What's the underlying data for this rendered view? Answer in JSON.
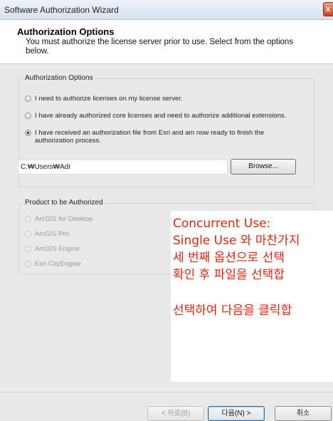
{
  "window": {
    "title": "Software Authorization Wizard",
    "close_label": "x"
  },
  "header": {
    "title": "Authorization Options",
    "subtitle": "You must authorize the license server prior to use. Select from the options below."
  },
  "auth_group": {
    "legend": "Authorization Options",
    "options": [
      {
        "label": "I need to authorize licenses on my license server.",
        "selected": false
      },
      {
        "label": "I have already authorized core licenses and need to authorize additional extensions.",
        "selected": false
      },
      {
        "label_line1": "I have received an authorization file from Esri and am now ready to finish the",
        "label_line2": "authorization process.",
        "selected": true
      }
    ],
    "path_value": "C:₩Users₩Adr",
    "browse_label": "Browse..."
  },
  "product_group": {
    "legend": "Product to be Authorized",
    "products": [
      "ArcGIS for Desktop",
      "ArcGIS Pro",
      "ArcGIS Engine",
      "Esri CityEngine"
    ]
  },
  "annotation": {
    "line1": "Concurrent Use:",
    "line2": "Single Use 와 마찬가지",
    "line3": "세 번째 옵션으로 선택",
    "line4": "확인 후 파일을 선택합",
    "line5": "선택하여 다음을 클릭합"
  },
  "footer": {
    "back_label": "< 뒤로(B)",
    "next_label": "다음(N) >",
    "cancel_label": "취소"
  },
  "colors": {
    "annotation": "#e8220b",
    "dialog_bg": "#e9e9e9"
  }
}
